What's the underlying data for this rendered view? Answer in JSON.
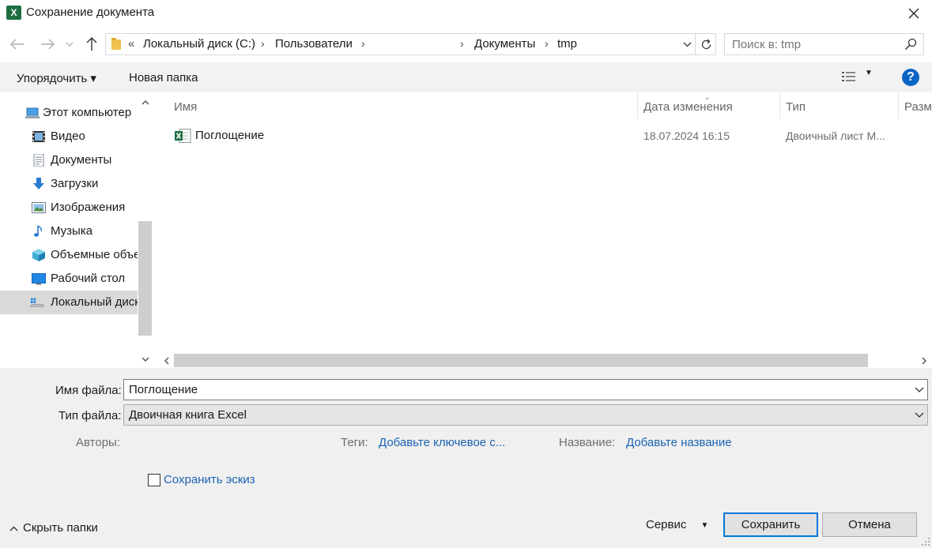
{
  "window": {
    "app_icon": "X",
    "title": "Сохранение документа"
  },
  "nav": {
    "back_icon": "arrow-left-icon",
    "forward_icon": "arrow-right-icon",
    "up_icon": "arrow-up-icon",
    "address": {
      "overflow": "«",
      "segments": [
        "Локальный диск (C:)",
        "Пользователи",
        "Документы",
        "tmp"
      ]
    },
    "search_placeholder": "Поиск в: tmp"
  },
  "toolbar": {
    "organize": "Упорядочить ▾",
    "new_folder": "Новая папка"
  },
  "sidebar": {
    "items": [
      {
        "label": "Этот компьютер",
        "icon": "computer-icon"
      },
      {
        "label": "Видео",
        "icon": "video-icon"
      },
      {
        "label": "Документы",
        "icon": "documents-icon"
      },
      {
        "label": "Загрузки",
        "icon": "downloads-icon"
      },
      {
        "label": "Изображения",
        "icon": "pictures-icon"
      },
      {
        "label": "Музыка",
        "icon": "music-icon"
      },
      {
        "label": "Объемные объекты",
        "icon": "3d-objects-icon"
      },
      {
        "label": "Рабочий стол",
        "icon": "desktop-icon"
      },
      {
        "label": "Локальный диск (C:)",
        "icon": "drive-icon",
        "selected": true
      }
    ]
  },
  "files": {
    "columns": [
      "Имя",
      "Дата изменения",
      "Тип",
      "Размер"
    ],
    "rows": [
      {
        "name": "Поглощение",
        "date": "18.07.2024 16:15",
        "type": "Двоичный лист M..."
      }
    ]
  },
  "form": {
    "filename_label": "Имя файла:",
    "filename_value": "Поглощение",
    "filetype_label": "Тип файла:",
    "filetype_value": "Двоичная книга Excel",
    "authors_label": "Авторы:",
    "tags_label": "Теги:",
    "tags_link": "Добавьте ключевое с...",
    "title_label": "Название:",
    "title_link": "Добавьте название",
    "thumbnail_label": "Сохранить эскиз",
    "thumbnail_checked": false
  },
  "footer": {
    "hide_folders": "Скрыть папки",
    "service": "Сервис",
    "save": "Сохранить",
    "cancel": "Отмена"
  }
}
